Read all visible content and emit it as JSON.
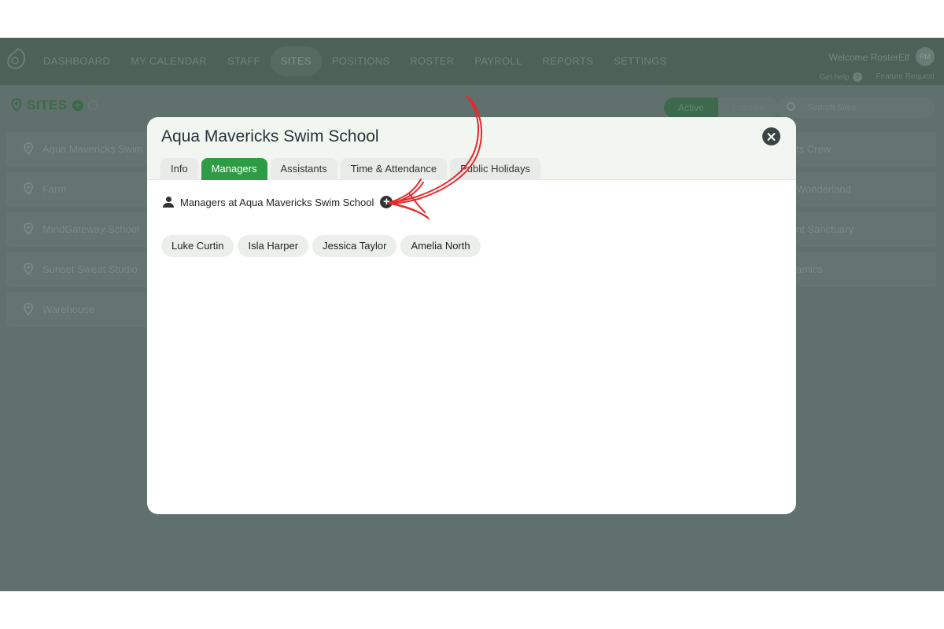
{
  "nav": {
    "items": [
      "DASHBOARD",
      "MY CALENDAR",
      "STAFF",
      "SITES",
      "POSITIONS",
      "ROSTER",
      "PAYROLL",
      "REPORTS",
      "SETTINGS"
    ],
    "welcome": "Welcome RosterElf",
    "avatar_initials": "RM",
    "help_label": "Get help",
    "feature_request": "Feature Request"
  },
  "page": {
    "title": "SITES",
    "filter_active": "Active",
    "filter_inactive": "Inactive",
    "search_placeholder": "Search Sites"
  },
  "sites_left": [
    "Aqua Mavericks Swim Sc",
    "Farm",
    "MindGateway School",
    "Sunset Sweat Studio",
    "Warehouse"
  ],
  "sites_right": [
    "ts Crew",
    "Wonderland",
    "nt Sanctuary",
    "amics"
  ],
  "modal": {
    "title": "Aqua Mavericks Swim School",
    "tabs": [
      "Info",
      "Managers",
      "Assistants",
      "Time & Attendance",
      "Public Holidays"
    ],
    "active_tab": "Managers",
    "section_label": "Managers at Aqua Mavericks Swim School",
    "managers": [
      "Luke Curtin",
      "Isla Harper",
      "Jessica Taylor",
      "Amelia North"
    ]
  },
  "colors": {
    "accent": "#2e9c45",
    "overlay": "#5f706d",
    "annotation": "#e8282b"
  }
}
